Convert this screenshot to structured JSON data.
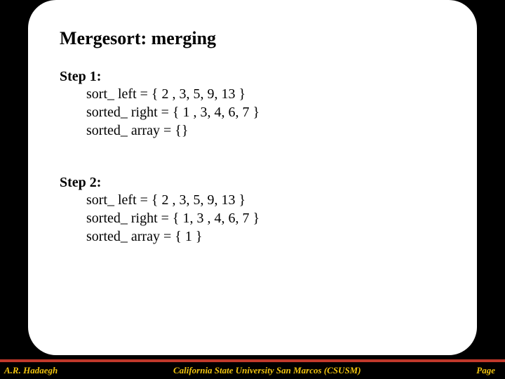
{
  "title": "Mergesort: merging",
  "steps": [
    {
      "head": "Step 1:",
      "lines": [
        "sort_ left = { 2 , 3, 5, 9, 13 }",
        "sorted_ right = { 1 , 3, 4, 6, 7 }",
        "sorted_ array = {}"
      ]
    },
    {
      "head": "Step 2:",
      "lines": [
        "sort_ left = { 2 , 3, 5, 9, 13 }",
        "sorted_ right = { 1, 3 , 4, 6, 7 }",
        "sorted_ array = { 1 }"
      ]
    }
  ],
  "footer": {
    "left": "A.R. Hadaegh",
    "center": "California State University San Marcos (CSUSM)",
    "right": "Page"
  }
}
